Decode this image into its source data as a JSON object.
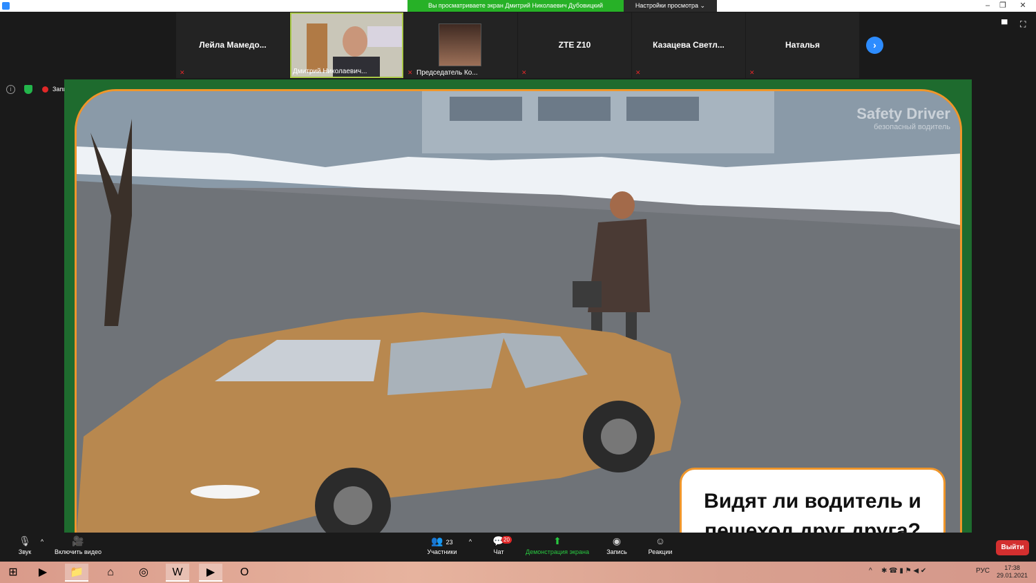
{
  "window": {
    "share_banner": "Вы просматриваете экран Дмитрий Николаевич Дубовицкий",
    "view_settings": "Настройки просмотра ⌄",
    "controls": [
      "–",
      "❐",
      "✕"
    ]
  },
  "participants": [
    {
      "name": "Лейла  Мамедо...",
      "muted": true,
      "type": "name"
    },
    {
      "name": "Дмитрий Николаевич...",
      "muted": false,
      "type": "video"
    },
    {
      "name": "Председатель Ко...",
      "muted": true,
      "type": "photo"
    },
    {
      "name": "ZTE Z10",
      "muted": true,
      "type": "name"
    },
    {
      "name": "Казацева  Светл...",
      "muted": true,
      "type": "name"
    },
    {
      "name": "Наталья",
      "muted": true,
      "type": "name"
    }
  ],
  "info_row": {
    "record_label": "Запись"
  },
  "shared_content": {
    "logo_main": "Safety Driver",
    "logo_sub": "безопасный водитель",
    "question": "Видят ли водитель и пешеход друг друга?"
  },
  "toolbar": {
    "audio_label": "Звук",
    "video_label": "Включить видео",
    "participants_label": "Участники",
    "participants_count": "23",
    "chat_label": "Чат",
    "chat_badge": "20",
    "share_label": "Демонстрация экрана",
    "record_label": "Запись",
    "reactions_label": "Реакции",
    "leave_label": "Выйти"
  },
  "taskbar": {
    "language": "РУС",
    "time": "17:38",
    "date": "29.01.2021"
  },
  "colors": {
    "zoom_blue": "#2d8cff",
    "share_green": "#27b127",
    "accent_orange": "#f0962a",
    "leave_red": "#d32f2f"
  }
}
